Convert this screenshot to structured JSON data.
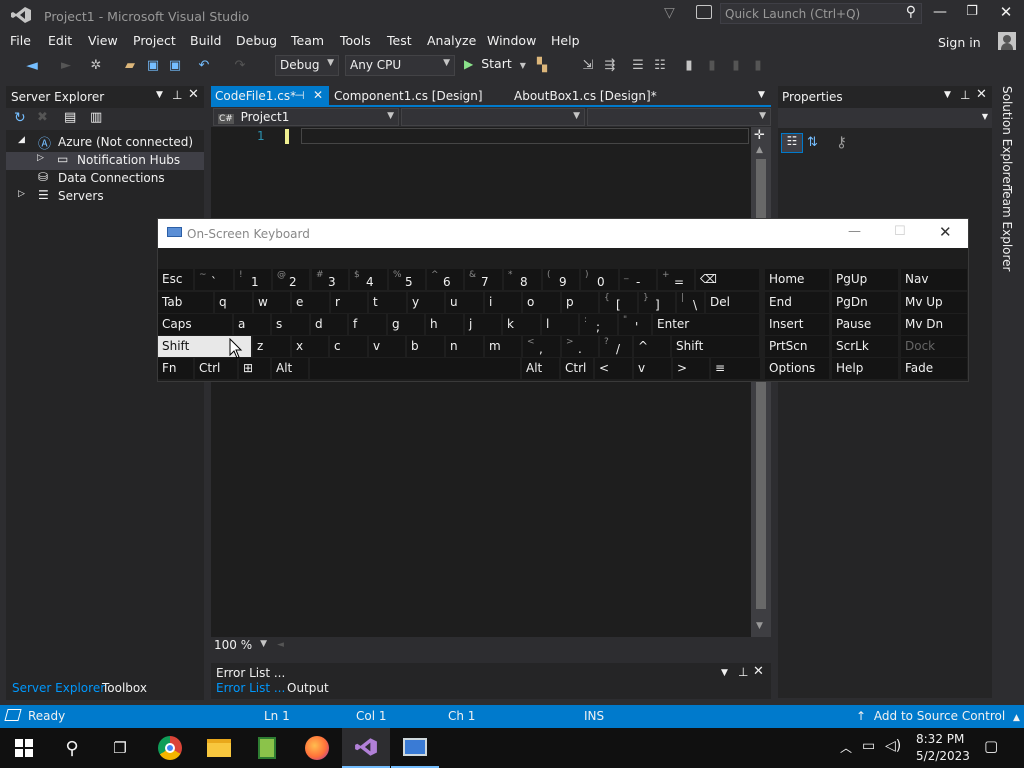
{
  "window": {
    "title": "Project1 - Microsoft Visual Studio",
    "quick_launch_placeholder": "Quick Launch (Ctrl+Q)",
    "sign_in": "Sign in"
  },
  "menu": [
    "File",
    "Edit",
    "View",
    "Project",
    "Build",
    "Debug",
    "Team",
    "Tools",
    "Test",
    "Analyze",
    "Window",
    "Help"
  ],
  "toolbar": {
    "config": "Debug",
    "platform": "Any CPU",
    "start_label": "Start"
  },
  "server_explorer": {
    "title": "Server Explorer",
    "tree": [
      {
        "label": "Azure (Not connected)",
        "expanded": true
      },
      {
        "label": "Notification Hubs",
        "selected": true
      },
      {
        "label": "Data Connections"
      },
      {
        "label": "Servers"
      }
    ],
    "bottom_tabs": [
      "Server Explorer",
      "Toolbox"
    ]
  },
  "editor": {
    "tabs": [
      "CodeFile1.cs*",
      "Component1.cs [Design]",
      "AboutBox1.cs [Design]*"
    ],
    "nav_project": "Project1",
    "line_number": "1",
    "zoom": "100 %"
  },
  "properties": {
    "title": "Properties",
    "side_tabs": [
      "Solution Explorer",
      "Team Explorer"
    ]
  },
  "error_list": {
    "title": "Error List ...",
    "tabs": [
      "Error List ...",
      "Output"
    ]
  },
  "osk": {
    "title": "On-Screen Keyboard",
    "rows": [
      [
        {
          "m": "Esc"
        },
        {
          "s": "~",
          "m": "`"
        },
        {
          "s": "!",
          "m": "1"
        },
        {
          "s": "@",
          "m": "2"
        },
        {
          "s": "#",
          "m": "3"
        },
        {
          "s": "$",
          "m": "4"
        },
        {
          "s": "%",
          "m": "5"
        },
        {
          "s": "^",
          "m": "6"
        },
        {
          "s": "&",
          "m": "7"
        },
        {
          "s": "*",
          "m": "8"
        },
        {
          "s": "(",
          "m": "9"
        },
        {
          "s": ")",
          "m": "0"
        },
        {
          "s": "_",
          "m": "-"
        },
        {
          "s": "+",
          "m": "="
        },
        {
          "m": "⌫"
        }
      ],
      [
        {
          "m": "Tab"
        },
        {
          "m": "q"
        },
        {
          "m": "w"
        },
        {
          "m": "e"
        },
        {
          "m": "r"
        },
        {
          "m": "t"
        },
        {
          "m": "y"
        },
        {
          "m": "u"
        },
        {
          "m": "i"
        },
        {
          "m": "o"
        },
        {
          "m": "p"
        },
        {
          "s": "{",
          "m": "["
        },
        {
          "s": "}",
          "m": "]"
        },
        {
          "s": "|",
          "m": "\\"
        },
        {
          "m": "Del"
        }
      ],
      [
        {
          "m": "Caps"
        },
        {
          "m": "a"
        },
        {
          "m": "s"
        },
        {
          "m": "d"
        },
        {
          "m": "f"
        },
        {
          "m": "g"
        },
        {
          "m": "h"
        },
        {
          "m": "j"
        },
        {
          "m": "k"
        },
        {
          "m": "l"
        },
        {
          "s": ":",
          "m": ";"
        },
        {
          "s": "\"",
          "m": "'"
        },
        {
          "m": "Enter"
        }
      ],
      [
        {
          "m": "Shift"
        },
        {
          "m": "z"
        },
        {
          "m": "x"
        },
        {
          "m": "c"
        },
        {
          "m": "v"
        },
        {
          "m": "b"
        },
        {
          "m": "n"
        },
        {
          "m": "m"
        },
        {
          "s": "<",
          "m": ","
        },
        {
          "s": ">",
          "m": "."
        },
        {
          "s": "?",
          "m": "/"
        },
        {
          "m": "^"
        },
        {
          "m": "Shift"
        }
      ],
      [
        {
          "m": "Fn"
        },
        {
          "m": "Ctrl"
        },
        {
          "m": "⊞"
        },
        {
          "m": "Alt"
        },
        {
          "m": ""
        },
        {
          "m": "Alt"
        },
        {
          "m": "Ctrl"
        },
        {
          "m": "<"
        },
        {
          "m": "v"
        },
        {
          "m": ">"
        },
        {
          "m": "≡"
        }
      ]
    ],
    "nav_keys": [
      [
        "Home",
        "PgUp",
        "Nav"
      ],
      [
        "End",
        "PgDn",
        "Mv Up"
      ],
      [
        "Insert",
        "Pause",
        "Mv Dn"
      ],
      [
        "PrtScn",
        "ScrLk",
        "Dock"
      ],
      [
        "Options",
        "Help",
        "Fade"
      ]
    ]
  },
  "status": {
    "ready": "Ready",
    "ln": "Ln 1",
    "col": "Col 1",
    "ch": "Ch 1",
    "ins": "INS",
    "source_control": "Add to Source Control"
  },
  "taskbar": {
    "time": "8:32 PM",
    "date": "5/2/2023"
  },
  "colors": {
    "accent": "#007acc",
    "bg": "#2d2d30",
    "editor_bg": "#1e1e1e",
    "osk_key": "#141414"
  }
}
